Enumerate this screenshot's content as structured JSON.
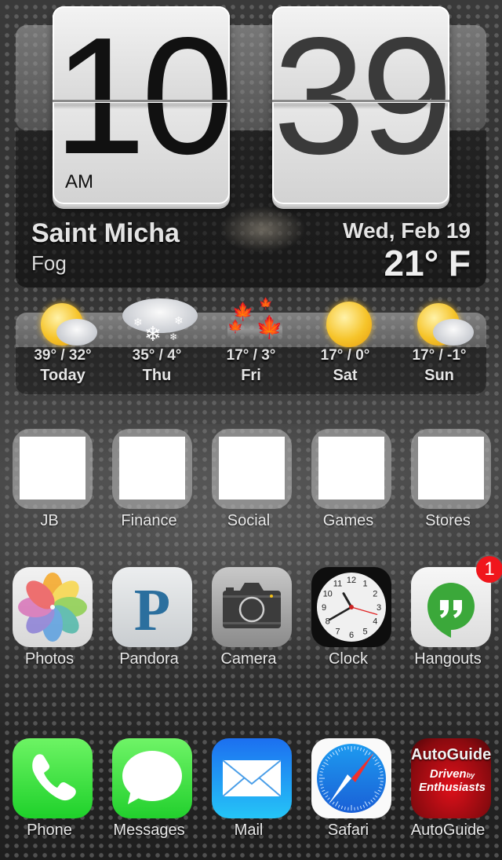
{
  "clock_widget": {
    "hours": "10",
    "minutes": "39",
    "ampm": "AM",
    "city": "Saint Micha",
    "condition": "Fog",
    "date": "Wed, Feb 19",
    "temperature": "21° F"
  },
  "forecast": [
    {
      "day": "Today",
      "range": "39° / 32°",
      "icon": "partly-cloudy-icon"
    },
    {
      "day": "Thu",
      "range": "35° / 4°",
      "icon": "snow-icon"
    },
    {
      "day": "Fri",
      "range": "17° / 3°",
      "icon": "windy-leaves-icon"
    },
    {
      "day": "Sat",
      "range": "17° / 0°",
      "icon": "hazy-sun-icon"
    },
    {
      "day": "Sun",
      "range": "17° / -1°",
      "icon": "partly-cloudy-icon"
    }
  ],
  "folders": [
    {
      "name": "JB"
    },
    {
      "name": "Finance"
    },
    {
      "name": "Social"
    },
    {
      "name": "Games"
    },
    {
      "name": "Stores"
    }
  ],
  "apps_row2": [
    {
      "name": "Photos",
      "icon": "photos-icon"
    },
    {
      "name": "Pandora",
      "icon": "pandora-icon",
      "glyph": "P"
    },
    {
      "name": "Camera",
      "icon": "camera-icon"
    },
    {
      "name": "Clock",
      "icon": "clock-icon"
    },
    {
      "name": "Hangouts",
      "icon": "hangouts-icon",
      "badge": "1"
    }
  ],
  "clock_app": {
    "numerals": [
      "12",
      "1",
      "2",
      "3",
      "4",
      "5",
      "6",
      "7",
      "8",
      "9",
      "10",
      "11"
    ]
  },
  "dock": [
    {
      "name": "Phone",
      "icon": "phone-icon",
      "color": "#2fd13a"
    },
    {
      "name": "Messages",
      "icon": "messages-icon",
      "color": "#30d33b"
    },
    {
      "name": "Mail",
      "icon": "mail-icon",
      "color": "#1a8cf2"
    },
    {
      "name": "Safari",
      "icon": "safari-icon",
      "color": "#1e88e5"
    },
    {
      "name": "AutoGuide",
      "icon": "autoguide-icon",
      "color": "#b5121b",
      "logo_title": "AutoGuide",
      "logo_line1": "Driven",
      "logo_by": "by",
      "logo_line2": "Enthusiasts"
    }
  ],
  "colors": {
    "badge_red": "#f0161c",
    "hangouts_green": "#3ba83a",
    "pandora_blue": "#2b6f9e"
  }
}
